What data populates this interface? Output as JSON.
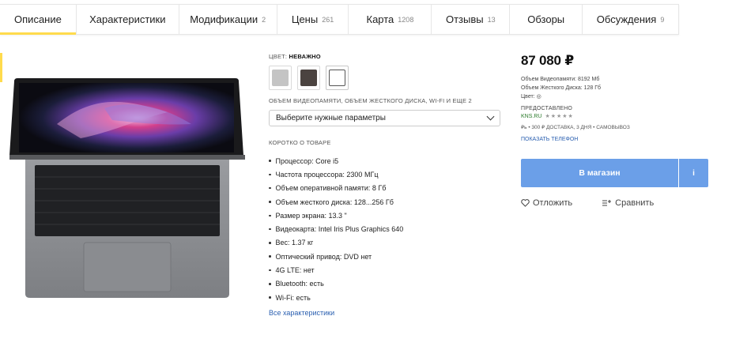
{
  "tabs": [
    {
      "label": "Описание",
      "count": ""
    },
    {
      "label": "Характеристики",
      "count": ""
    },
    {
      "label": "Модификации",
      "count": "2"
    },
    {
      "label": "Цены",
      "count": "261"
    },
    {
      "label": "Карта",
      "count": "1208"
    },
    {
      "label": "Отзывы",
      "count": "13"
    },
    {
      "label": "Обзоры",
      "count": ""
    },
    {
      "label": "Обсуждения",
      "count": "9"
    }
  ],
  "color": {
    "label": "ЦВЕТ:",
    "value": "НЕВАЖНО",
    "swatches": [
      "#c4c4c4",
      "#4b4340",
      "#ffffff"
    ]
  },
  "params": {
    "label": "ОБЪЕМ ВИДЕОПАМЯТИ, ОБЪЕМ ЖЕСТКОГО ДИСКА, WI-FI И ЕЩЕ 2",
    "select_value": "Выберите нужные параметры"
  },
  "short": {
    "label": "КОРОТКО О ТОВАРЕ",
    "specs": [
      "Процессор: Core i5",
      "Частота процессора: 2300 МГц",
      "Объем оперативной памяти: 8 Гб",
      "Объем жесткого диска: 128...256 Гб",
      "Размер экрана: 13.3 \"",
      "Видеокарта: Intel Iris Plus Graphics 640",
      "Вес: 1.37 кг",
      "Оптический привод: DVD нет",
      "4G LTE: нет",
      "Bluetooth: есть",
      "Wi-Fi: есть"
    ],
    "all_link": "Все характеристики"
  },
  "offer": {
    "price": "87 080 ₽",
    "info_lines": [
      "Объем Видеопамяти: 8192 Мб",
      "Объем Жесткого Диска: 128 Гб",
      "Цвет: ◎"
    ],
    "provided": "ПРЕДОСТАВЛЕНО",
    "shop": "KNS.RU",
    "stars": "★★★★★",
    "delivery": "₽ь • 300 ₽ ДОСТАВКА, 3 ДНЯ • САМОВЫВОЗ",
    "phone": "ПОКАЗАТЬ ТЕЛЕФОН",
    "buy": "В магазин",
    "info_btn": "i",
    "defer": "Отложить",
    "compare": "Сравнить"
  },
  "accent": {
    "tab": "#ffdb4d",
    "button": "#6b9fe8",
    "link": "#2a5fb0",
    "shop": "#2a7a2a"
  }
}
